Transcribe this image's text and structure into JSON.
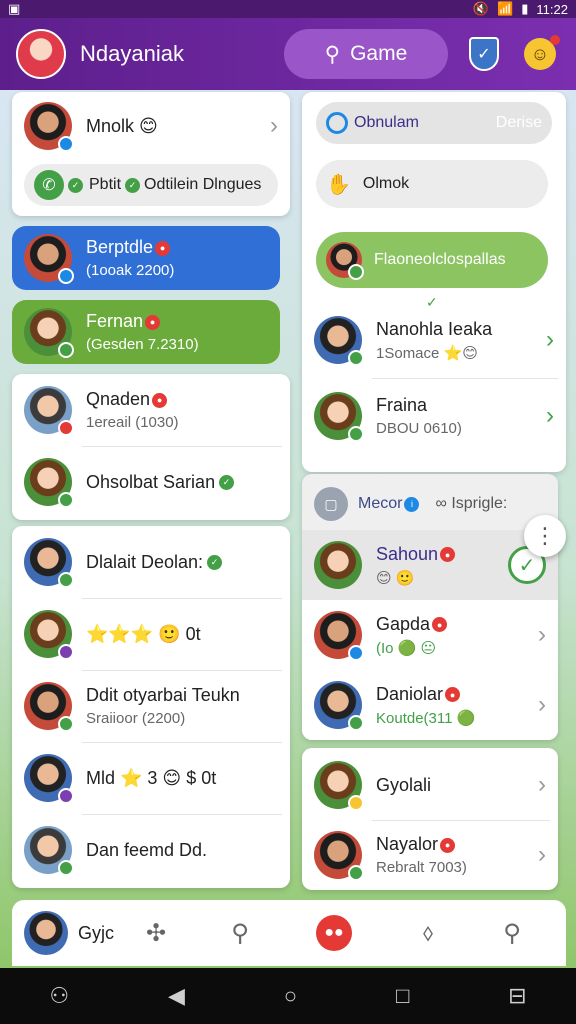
{
  "status_bar": {
    "time": "11:22"
  },
  "header": {
    "title": "Ndayaniak",
    "game_button_label": "Game",
    "search_glyph": "⌕"
  },
  "left_top_panel": {
    "profile_row": {
      "name": "Mnolk 😊"
    },
    "call_pill": {
      "label": "Pbtit",
      "label2": "Odtilein Dlngues"
    }
  },
  "left_cards": [
    {
      "name": "Berptdle",
      "sub": "(1ooak 2200)",
      "color": "blue"
    },
    {
      "name": "Fernan",
      "sub": "(Gesden 7.2310)",
      "color": "green"
    }
  ],
  "left_list_a": [
    {
      "name": "Qnaden",
      "sub": "1ereail (1030)"
    },
    {
      "name": "Ohsolbat Sarian",
      "sub": ""
    }
  ],
  "left_list_b": [
    {
      "name": "Dlalait Deolan:",
      "sub": ""
    },
    {
      "name": "⭐⭐⭐ 🙂 0t",
      "sub": ""
    },
    {
      "name": "Ddit otyarbai Teukn",
      "sub": "Sraiioor (2200)"
    },
    {
      "name": "Mld ⭐ 3 😊 $ 0t",
      "sub": ""
    },
    {
      "name": "Dan feemd Dd.",
      "sub": ""
    }
  ],
  "right_top_panel": {
    "pill1": {
      "label": "Obnulam",
      "action": "Derise"
    },
    "pill2": {
      "label": "Olmok"
    },
    "green_pill": {
      "label": "Flaoneolclospallas"
    },
    "rows": [
      {
        "name": "Nanohla Ieaka",
        "sub": "1Somace ⭐😊"
      },
      {
        "name": "Fraina",
        "sub": "DBOU 0610)"
      }
    ]
  },
  "right_mid_panel": {
    "tab1": "Mecor",
    "tab2": "Isprigle:",
    "rows": [
      {
        "name": "Sahoun",
        "sub": "😊 🙂",
        "selected": true
      },
      {
        "name": "Gapda",
        "sub": "(Io 🟢 😐"
      },
      {
        "name": "Daniolar",
        "sub": "Koutde(311 🟢"
      }
    ]
  },
  "right_bottom_panel": {
    "rows": [
      {
        "name": "Gyolali",
        "sub": ""
      },
      {
        "name": "Nayalor",
        "sub": "Rebralt 7003)"
      }
    ]
  },
  "bottom_nav": {
    "user_label": "Gyjc"
  }
}
